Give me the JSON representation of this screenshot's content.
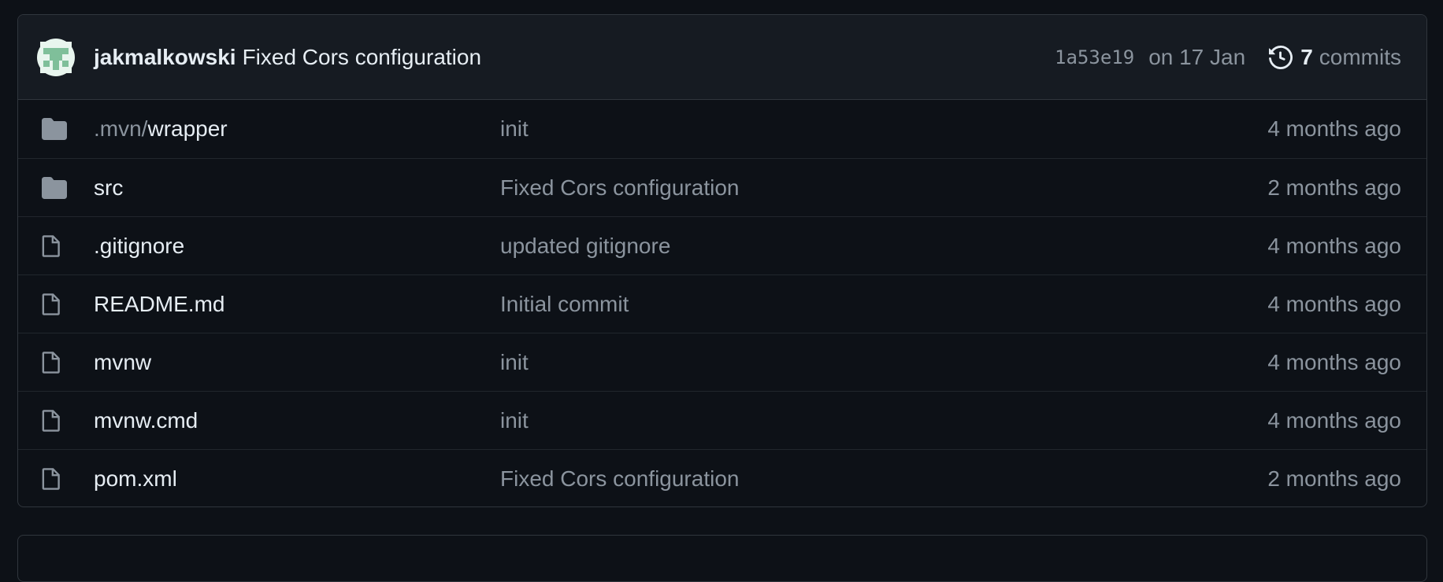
{
  "latest_commit": {
    "author": "jakmalkowski",
    "message": "Fixed Cors configuration",
    "sha": "1a53e19",
    "date": "on 17 Jan",
    "commit_count": "7",
    "commits_label": "commits"
  },
  "files": [
    {
      "type": "folder",
      "prefix": ".mvn/",
      "name": "wrapper",
      "message": "init",
      "time": "4 months ago"
    },
    {
      "type": "folder",
      "prefix": "",
      "name": "src",
      "message": "Fixed Cors configuration",
      "time": "2 months ago"
    },
    {
      "type": "file",
      "prefix": "",
      "name": ".gitignore",
      "message": "updated gitignore",
      "time": "4 months ago"
    },
    {
      "type": "file",
      "prefix": "",
      "name": "README.md",
      "message": "Initial commit",
      "time": "4 months ago"
    },
    {
      "type": "file",
      "prefix": "",
      "name": "mvnw",
      "message": "init",
      "time": "4 months ago"
    },
    {
      "type": "file",
      "prefix": "",
      "name": "mvnw.cmd",
      "message": "init",
      "time": "4 months ago"
    },
    {
      "type": "file",
      "prefix": "",
      "name": "pom.xml",
      "message": "Fixed Cors configuration",
      "time": "2 months ago"
    }
  ],
  "colors": {
    "background": "#0d1117",
    "header_background": "#161b22",
    "border": "#30363d",
    "text_primary": "#e6edf3",
    "text_muted": "#8b949e",
    "icon": "#8b949e",
    "avatar_accent": "#7fbf9a"
  }
}
